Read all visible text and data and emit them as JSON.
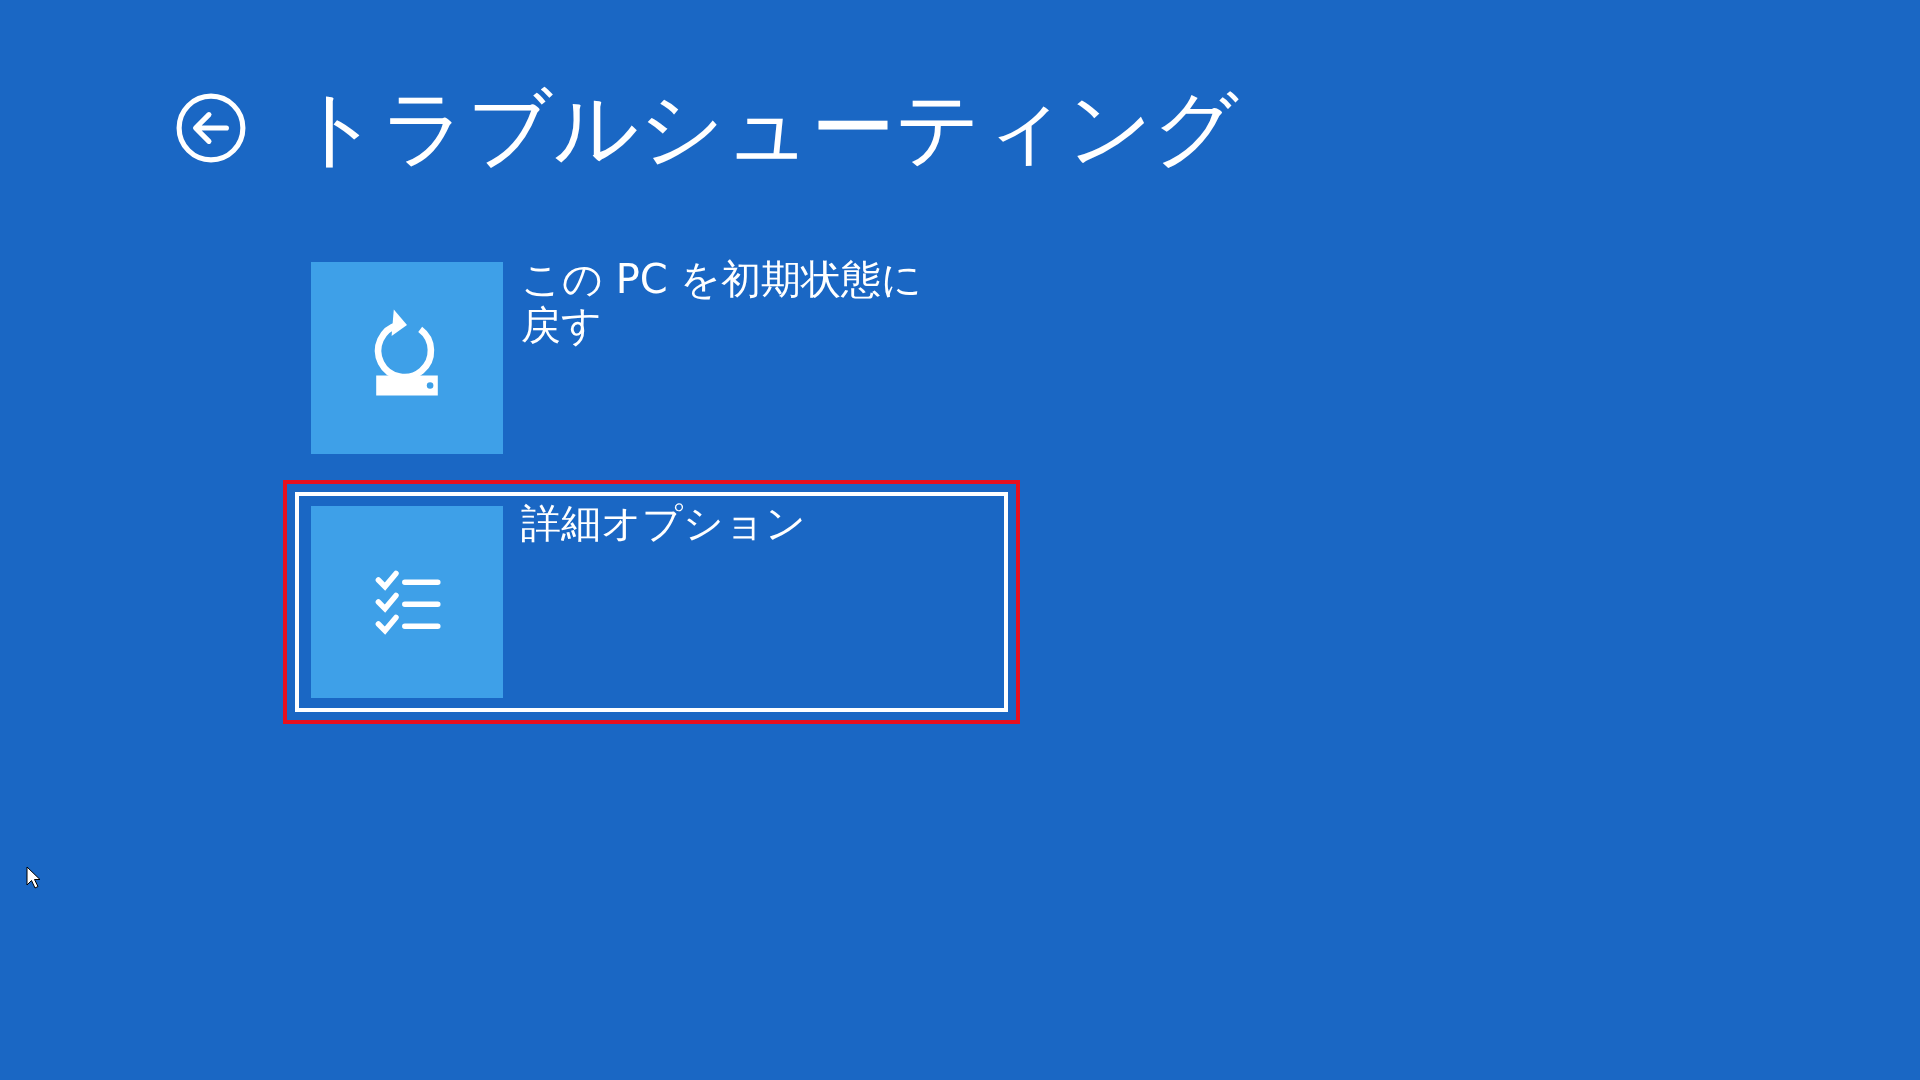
{
  "title": "トラブルシューティング",
  "options": [
    {
      "label": "この PC を初期状態に戻す",
      "kind": "reset",
      "selected": false
    },
    {
      "label": "詳細オプション",
      "kind": "advanced",
      "selected": true
    }
  ]
}
